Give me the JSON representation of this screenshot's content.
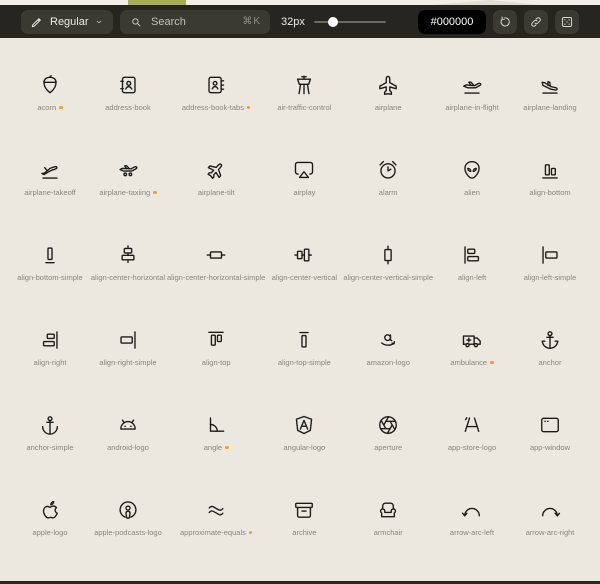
{
  "colors": {
    "page_bg": "#ECE8E0",
    "toolbar_bg": "#262520",
    "control_bg": "#3B3A32",
    "icon_color": "#1C1B18",
    "label_color": "#8A857C",
    "accent_dot": "#E9A23B",
    "hero_green": "#A4AE53"
  },
  "toolbar": {
    "style_dropdown": {
      "label": "Regular",
      "icon": "pencil-icon",
      "chevron": "chevron-down-icon"
    },
    "search": {
      "placeholder": "Search",
      "shortcut": "⌘K",
      "icon": "search-icon"
    },
    "size": {
      "label": "32px",
      "slider_percent": 27
    },
    "color": {
      "value": "#000000"
    },
    "buttons": [
      {
        "icon": "undo"
      },
      {
        "icon": "link"
      },
      {
        "icon": "selection"
      }
    ]
  },
  "grid": {
    "items": [
      {
        "label": "acorn",
        "icon": "acorn",
        "new": true
      },
      {
        "label": "address-book",
        "icon": "address-book",
        "new": false
      },
      {
        "label": "address-book-tabs",
        "icon": "address-book-tabs",
        "new": true
      },
      {
        "label": "air-traffic-control",
        "icon": "air-traffic-control",
        "new": false
      },
      {
        "label": "airplane",
        "icon": "airplane",
        "new": false
      },
      {
        "label": "airplane-in-flight",
        "icon": "airplane-in-flight",
        "new": false
      },
      {
        "label": "airplane-landing",
        "icon": "airplane-landing",
        "new": false
      },
      {
        "label": "airplane-takeoff",
        "icon": "airplane-takeoff",
        "new": false
      },
      {
        "label": "airplane-taxiing",
        "icon": "airplane-taxiing",
        "new": true
      },
      {
        "label": "airplane-tilt",
        "icon": "airplane-tilt",
        "new": false
      },
      {
        "label": "airplay",
        "icon": "airplay",
        "new": false
      },
      {
        "label": "alarm",
        "icon": "alarm",
        "new": false
      },
      {
        "label": "alien",
        "icon": "alien",
        "new": false
      },
      {
        "label": "align-bottom",
        "icon": "align-bottom",
        "new": false
      },
      {
        "label": "align-bottom-simple",
        "icon": "align-bottom-simple",
        "new": false
      },
      {
        "label": "align-center-horizontal",
        "icon": "align-center-horizontal",
        "new": false
      },
      {
        "label": "align-center-horizontal-simple",
        "icon": "align-center-horizontal-simple",
        "new": false
      },
      {
        "label": "align-center-vertical",
        "icon": "align-center-vertical",
        "new": false
      },
      {
        "label": "align-center-vertical-simple",
        "icon": "align-center-vertical-simple",
        "new": false
      },
      {
        "label": "align-left",
        "icon": "align-left",
        "new": false
      },
      {
        "label": "align-left-simple",
        "icon": "align-left-simple",
        "new": false
      },
      {
        "label": "align-right",
        "icon": "align-right",
        "new": false
      },
      {
        "label": "align-right-simple",
        "icon": "align-right-simple",
        "new": false
      },
      {
        "label": "align-top",
        "icon": "align-top",
        "new": false
      },
      {
        "label": "align-top-simple",
        "icon": "align-top-simple",
        "new": false
      },
      {
        "label": "amazon-logo",
        "icon": "amazon-logo",
        "new": false
      },
      {
        "label": "ambulance",
        "icon": "ambulance",
        "new": true
      },
      {
        "label": "anchor",
        "icon": "anchor",
        "new": false
      },
      {
        "label": "anchor-simple",
        "icon": "anchor-simple",
        "new": false
      },
      {
        "label": "android-logo",
        "icon": "android-logo",
        "new": false
      },
      {
        "label": "angle",
        "icon": "angle",
        "new": true
      },
      {
        "label": "angular-logo",
        "icon": "angular-logo",
        "new": false
      },
      {
        "label": "aperture",
        "icon": "aperture",
        "new": false
      },
      {
        "label": "app-store-logo",
        "icon": "app-store-logo",
        "new": false
      },
      {
        "label": "app-window",
        "icon": "app-window",
        "new": false
      },
      {
        "label": "apple-logo",
        "icon": "apple-logo",
        "new": false
      },
      {
        "label": "apple-podcasts-logo",
        "icon": "apple-podcasts-logo",
        "new": false
      },
      {
        "label": "approximate-equals",
        "icon": "approximate-equals",
        "new": true
      },
      {
        "label": "archive",
        "icon": "archive",
        "new": false
      },
      {
        "label": "armchair",
        "icon": "armchair",
        "new": false
      },
      {
        "label": "arrow-arc-left",
        "icon": "arrow-arc-left",
        "new": false
      },
      {
        "label": "arrow-arc-right",
        "icon": "arrow-arc-right",
        "new": false
      }
    ]
  }
}
